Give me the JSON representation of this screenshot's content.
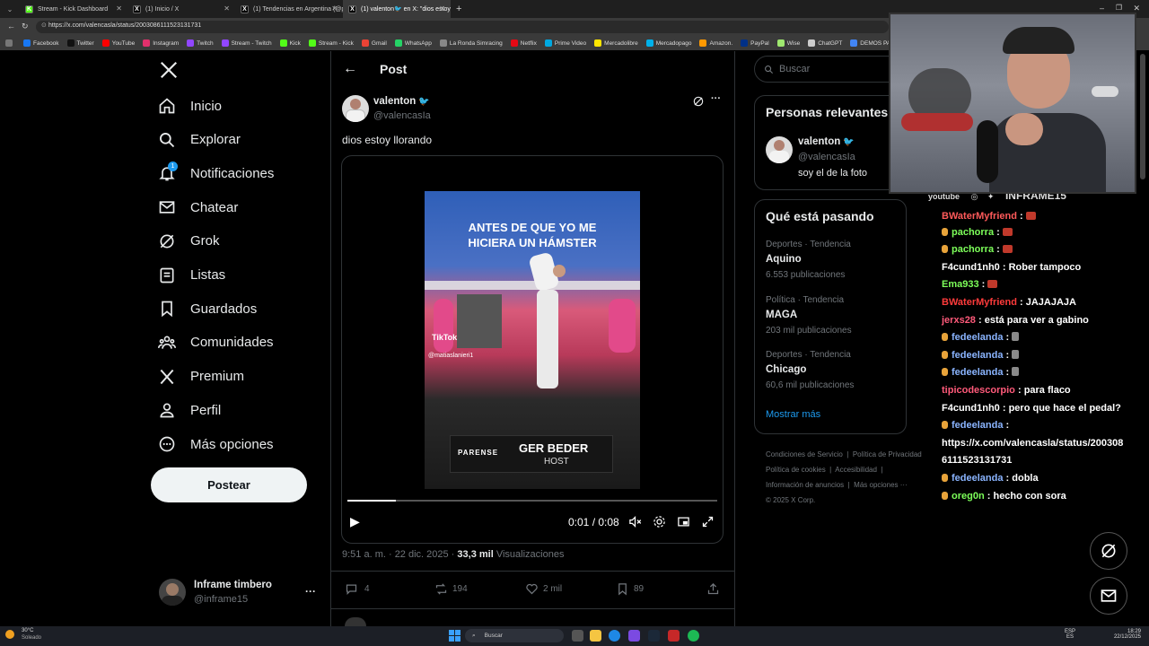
{
  "browser": {
    "tabs": [
      {
        "title": "Stream - Kick Dashboard",
        "icon": "kick-icon",
        "color": "#53fc18",
        "active": false
      },
      {
        "title": "(1) Inicio / X",
        "icon": "x-icon",
        "color": "#000000",
        "active": false
      },
      {
        "title": "(1) Tendencias en Argentina (@pa",
        "icon": "x-icon",
        "color": "#000000",
        "active": false
      },
      {
        "title": "(1) valenton🐦 en X: \"dios estoy ll",
        "icon": "x-icon",
        "color": "#000000",
        "active": true
      }
    ],
    "new_tab": "+",
    "url": "https://x.com/valencasla/status/2003086111523131731",
    "bookmarks": [
      {
        "label": "Facebook",
        "color": "#1877f2"
      },
      {
        "label": "Twitter",
        "color": "#111111"
      },
      {
        "label": "YouTube",
        "color": "#ff0000"
      },
      {
        "label": "Instagram",
        "color": "#e1306c"
      },
      {
        "label": "Twitch",
        "color": "#9146ff"
      },
      {
        "label": "Stream - Twitch",
        "color": "#9146ff"
      },
      {
        "label": "Kick",
        "color": "#53fc18"
      },
      {
        "label": "Stream - Kick",
        "color": "#53fc18"
      },
      {
        "label": "Gmail",
        "color": "#ea4335"
      },
      {
        "label": "WhatsApp",
        "color": "#25d366"
      },
      {
        "label": "La Ronda Simracing",
        "color": "#888888"
      },
      {
        "label": "Netflix",
        "color": "#e50914"
      },
      {
        "label": "Prime Video",
        "color": "#00a8e1"
      },
      {
        "label": "Mercadolibre",
        "color": "#ffe600"
      },
      {
        "label": "Mercadopago",
        "color": "#00b1ea"
      },
      {
        "label": "Amazon.",
        "color": "#ff9900"
      },
      {
        "label": "PayPal",
        "color": "#003087"
      },
      {
        "label": "Wise",
        "color": "#9fe870"
      },
      {
        "label": "ChatGPT",
        "color": "#cccccc"
      },
      {
        "label": "DEMOS PAL ST",
        "color": "#4285f4"
      }
    ]
  },
  "nav": {
    "items": [
      {
        "label": "Inicio",
        "icon": "home-icon"
      },
      {
        "label": "Explorar",
        "icon": "search-icon"
      },
      {
        "label": "Notificaciones",
        "icon": "bell-icon",
        "badge": "1"
      },
      {
        "label": "Chatear",
        "icon": "mail-icon"
      },
      {
        "label": "Grok",
        "icon": "grok-icon"
      },
      {
        "label": "Listas",
        "icon": "list-icon"
      },
      {
        "label": "Guardados",
        "icon": "bookmark-icon"
      },
      {
        "label": "Comunidades",
        "icon": "communities-icon"
      },
      {
        "label": "Premium",
        "icon": "x-icon"
      },
      {
        "label": "Perfil",
        "icon": "person-icon"
      },
      {
        "label": "Más opciones",
        "icon": "more-circle-icon"
      }
    ],
    "post_button": "Postear",
    "account": {
      "name": "Inframe timbero",
      "handle": "@inframe15",
      "more": "···"
    }
  },
  "post": {
    "header_title": "Post",
    "author_name": "valenton",
    "author_handle": "@valencasIa",
    "text": "dios estoy llorando",
    "video": {
      "caption_top": "ANTES DE QUE YO ME HICIERA UN HÁMSTER",
      "watermark": "TikTok",
      "watermark_user": "@matiaslanieri1",
      "lower_left": "PARENSE",
      "lower_right_title": "GER BEDER",
      "lower_right_sub": "HOST",
      "time": "0:01 / 0:08",
      "progress": 0.13
    },
    "timestamp": "9:51 a. m. · 22 dic. 2025 · ",
    "views_count": "33,3 mil",
    "views_label": "Visualizaciones",
    "actions": {
      "replies": "4",
      "reposts": "194",
      "likes": "2 mil",
      "bookmarks": "89"
    }
  },
  "sidebar": {
    "search_placeholder": "Buscar",
    "relevant_title": "Personas relevantes",
    "relevant_person": {
      "name": "valenton",
      "handle": "@valencasIa",
      "bio": "soy el de la foto"
    },
    "happening_title": "Qué está pasando",
    "trends": [
      {
        "meta": "Deportes · Tendencia",
        "title": "Aquino",
        "count": "6.553 publicaciones"
      },
      {
        "meta": "Política · Tendencia",
        "title": "MAGA",
        "count": "203 mil publicaciones"
      },
      {
        "meta": "Deportes · Tendencia",
        "title": "Chicago",
        "count": "60,6 mil publicaciones"
      }
    ],
    "show_more": "Mostrar más",
    "footer": [
      "Condiciones de Servicio",
      "|",
      "Política de Privacidad",
      "Política de cookies",
      "|",
      "Accesibilidad",
      "|",
      "Información de anuncios",
      "|",
      "Más opciones ···",
      "© 2025 X Corp."
    ]
  },
  "overlay": {
    "social_bar": "youtube",
    "channel": "INFRAME15",
    "chat": [
      {
        "user": "BWaterMyfriend",
        "color": "#ff5a5a",
        "text": "",
        "emote": true,
        "badge": false
      },
      {
        "user": "pachorra",
        "color": "#7dff5a",
        "text": "",
        "emote": true,
        "badge": true
      },
      {
        "user": "pachorra",
        "color": "#7dff5a",
        "text": "",
        "emote": true,
        "badge": true
      },
      {
        "user": "F4cund1nh0",
        "color": "#ffffff",
        "text": "Rober tampoco",
        "emote": false,
        "badge": false
      },
      {
        "user": "Ema933",
        "color": "#7dff5a",
        "text": "",
        "emote": true,
        "badge": false
      },
      {
        "user": "BWaterMyfriend",
        "color": "#ff3b3b",
        "text": "JAJAJAJA",
        "emote": false,
        "badge": false
      },
      {
        "user": "jerxs28",
        "color": "#ff5a7a",
        "text": "está para ver a gabino",
        "emote": false,
        "badge": false
      },
      {
        "user": "fedeelanda",
        "color": "#8ab4ff",
        "text": "",
        "emote2": true,
        "badge": true
      },
      {
        "user": "fedeelanda",
        "color": "#8ab4ff",
        "text": "",
        "emote2": true,
        "badge": true
      },
      {
        "user": "fedeelanda",
        "color": "#8ab4ff",
        "text": "",
        "emote2": true,
        "badge": true
      },
      {
        "user": "tipicodescorpio",
        "color": "#ff5a7a",
        "text": "para flaco",
        "emote": false,
        "badge": false
      },
      {
        "user": "F4cund1nh0",
        "color": "#ffffff",
        "text": "pero que hace el pedal?",
        "emote": false,
        "badge": false
      },
      {
        "user": "fedeelanda",
        "color": "#8ab4ff",
        "text": "",
        "emote": false,
        "badge": true
      },
      {
        "user": "",
        "color": "#ffffff",
        "text": "https://x.com/valencasla/status/200308",
        "emote": false,
        "badge": false
      },
      {
        "user": "",
        "color": "#ffffff",
        "text": "6111523131731",
        "emote": false,
        "badge": false
      },
      {
        "user": "fedeelanda",
        "color": "#8ab4ff",
        "text": "dobla",
        "emote": false,
        "badge": true
      },
      {
        "user": "oreg0n",
        "color": "#7dff5a",
        "text": "hecho con sora",
        "emote": false,
        "badge": true
      }
    ]
  },
  "taskbar": {
    "weather_temp": "30°C",
    "weather_desc": "Soleado",
    "search": "Buscar",
    "lang": "ESP",
    "lang_sub": "ES",
    "time": "18:29",
    "date": "22/12/2025"
  }
}
